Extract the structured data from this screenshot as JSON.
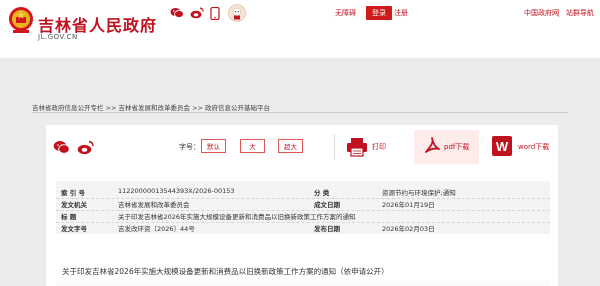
{
  "header": {
    "site_title": "吉林省人民政府",
    "site_domain": "JL.GOV.CN",
    "links": {
      "barrier_free": "无障碍",
      "login": "登录",
      "register": "注册",
      "cn_gov": "中国政府网",
      "site_search": "站群导航"
    },
    "social_icons": [
      "wechat-icon",
      "weibo-icon",
      "app-icon",
      "mascot-icon"
    ]
  },
  "breadcrumb": {
    "text": "吉林省政府信息公开专栏 >> 吉林省发展和改革委员会 >> 政府信息公开基础平台"
  },
  "toolbar": {
    "font_label": "字号：",
    "font_default": "默认",
    "font_large": "大",
    "font_xlarge": "超大",
    "print": "打印",
    "pdf": "pdf下载",
    "word": "word下载"
  },
  "metadata": {
    "rows": [
      {
        "label": "索  引  号",
        "value": "11220000013544393X/2026-00153",
        "label2": "分      类",
        "value2": "资源节约与环境保护;通知"
      },
      {
        "label": "发文机关",
        "value": "吉林省发展和改革委员会",
        "label2": "成文日期",
        "value2": "2026年01月19日"
      },
      {
        "label": "标      题",
        "value": "关于印发吉林省2026年实施大规模设备更新和消费品以旧换新政策工作方案的通知",
        "label2": "",
        "value2": ""
      },
      {
        "label": "发文字号",
        "value": "吉发改环资〔2026〕44号",
        "label2": "发布日期",
        "value2": "2026年02月03日"
      }
    ]
  },
  "document": {
    "title": "关于印发吉林省2026年实施大规模设备更新和消费品以旧换新政策工作方案的通知（依申请公开）"
  },
  "colors": {
    "accent_red": "#c0121e",
    "button_red": "#d01b1b",
    "band_gray": "#ececec",
    "meta_bg": "#f4f4f4"
  }
}
